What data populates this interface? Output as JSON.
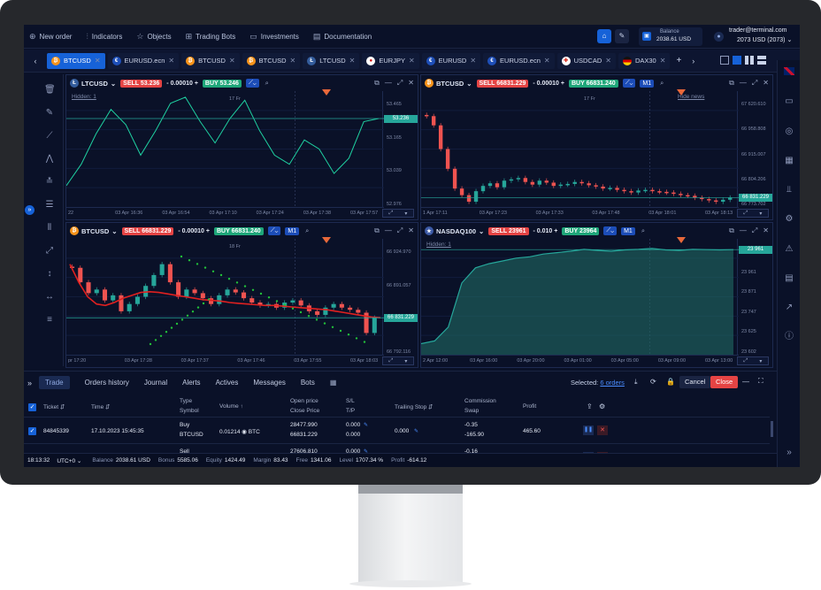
{
  "menu": [
    {
      "icon": "plus-circle-icon",
      "label": "New order"
    },
    {
      "icon": "indicators-icon",
      "label": "Indicators"
    },
    {
      "icon": "star-icon",
      "label": "Objects"
    },
    {
      "icon": "bot-icon",
      "label": "Trading Bots"
    },
    {
      "icon": "wallet-icon",
      "label": "Investments"
    },
    {
      "icon": "doc-icon",
      "label": "Documentation"
    }
  ],
  "balance": {
    "label": "Balance",
    "value": "2038.61 USD"
  },
  "account": {
    "email": "trader@terminal.com",
    "line": "2073 USD (2073)"
  },
  "tabs": [
    {
      "label": "BTCUSD",
      "flag": "btc",
      "active": true
    },
    {
      "label": "EURUSD.ecn",
      "flag": "eu"
    },
    {
      "label": "BTCUSD",
      "flag": "btc"
    },
    {
      "label": "BTCUSD",
      "flag": "btc"
    },
    {
      "label": "LTCUSD",
      "flag": "ltc"
    },
    {
      "label": "EURJPY",
      "flag": "jp"
    },
    {
      "label": "EURUSD",
      "flag": "eu"
    },
    {
      "label": "EURUSD.ecn",
      "flag": "eu"
    },
    {
      "label": "USDCAD",
      "flag": "ca"
    },
    {
      "label": "DAX30",
      "flag": "de"
    }
  ],
  "charts": [
    {
      "symbol": "LTCUSD",
      "sell": "53.236",
      "spread": "- 0.00010 +",
      "buy": "53.246",
      "tf": "",
      "hidden": "Hidden: 1",
      "yticks": [
        "53.465",
        "53.165",
        "53.039",
        "52.976"
      ],
      "price": "53.236",
      "xticks": [
        "22",
        "03 Apr 16:36",
        "03 Apr 16:54",
        "03 Apr 17:10",
        "03 Apr 17:24",
        "03 Apr 17:38",
        "03 Apr 17:57"
      ],
      "marker": "17 Fr"
    },
    {
      "symbol": "BTCUSD",
      "sell": "66831.229",
      "spread": "- 0.00010 +",
      "buy": "66831.240",
      "tf": "M1",
      "hidden": "Hide news",
      "yticks": [
        "67 620.610",
        "66 958.808",
        "66 915.007",
        "66 804.206",
        "66 773.702"
      ],
      "price": "66 831.229",
      "xticks": [
        "1 Apr 17:11",
        "03 Apr 17:23",
        "03 Apr 17:33",
        "03 Apr 17:48",
        "03 Apr 18:01",
        "03 Apr 18:13"
      ],
      "marker": "17 Fr"
    },
    {
      "symbol": "BTCUSD",
      "sell": "66831.229",
      "spread": "- 0.00010 +",
      "buy": "66831.240",
      "tf": "M1",
      "hidden": "",
      "yticks": [
        "66 924.970",
        "66 891.057",
        "66 858.543",
        "66 792.116"
      ],
      "price": "66 831.229",
      "xticks": [
        "pr 17:20",
        "03 Apr 17:28",
        "03 Apr 17:37",
        "03 Apr 17:46",
        "03 Apr 17:55",
        "03 Apr 18:03"
      ],
      "marker": "18 Fr"
    },
    {
      "symbol": "NASDAQ100",
      "sell": "23961",
      "spread": "- 0.010 +",
      "buy": "23964",
      "tf": "M1",
      "hidden": "Hidden: 1",
      "yticks": [
        "23 980",
        "23 961",
        "23 871",
        "23 747",
        "23 625",
        "23 602"
      ],
      "price": "23 961",
      "xticks": [
        "2 Apr 12:00",
        "03 Apr 16:00",
        "03 Apr 20:00",
        "03 Apr 01:00",
        "03 Apr 05:00",
        "03 Apr 09:00",
        "03 Apr 13:00"
      ],
      "marker": ""
    }
  ],
  "panel": {
    "tabs": [
      "Trade",
      "Orders history",
      "Journal",
      "Alerts",
      "Actives",
      "Messages",
      "Bots"
    ],
    "selected_label": "Selected:",
    "selected_value": "6 orders",
    "cancel": "Cancel",
    "close": "Close",
    "headers": {
      "ticket": "Ticket ⇵",
      "time": "Time ⇵",
      "type": "Type",
      "symbol": "Symbol",
      "volume": "Volume ↑",
      "open": "Open price",
      "closep": "Close Price",
      "sl": "S/L",
      "tp": "T/P",
      "trailing": "Trailing Stop ⇵",
      "commission": "Commission",
      "swap": "Swap",
      "profit": "Profit"
    },
    "rows": [
      {
        "ticket": "84845339",
        "time": "17.10.2023 15:45:35",
        "type": "Buy",
        "symbol": "BTCUSD",
        "volume": "0.01214 ◉ BTC",
        "open": "28477.990",
        "closep": "66831.229",
        "sl": "0.000",
        "tp": "0.000",
        "trailing": "0.000",
        "commission": "-0.35",
        "swap": "-165.90",
        "profit": "465.60"
      },
      {
        "ticket": "84580332",
        "time": "17.10.2023 15:45:35",
        "type": "Sell",
        "symbol": "BTCUSD",
        "volume": "",
        "open": "27606.810",
        "closep": "",
        "sl": "0.000",
        "tp": "",
        "trailing": "",
        "commission": "-0.16",
        "swap": "",
        "profit": "-325.55"
      }
    ]
  },
  "status": {
    "time": "18:13:32",
    "tz": "UTC+0",
    "items": [
      {
        "k": "Balance",
        "v": "2038.61 USD"
      },
      {
        "k": "Bonus",
        "v": "5585.06"
      },
      {
        "k": "Equity",
        "v": "1424.49"
      },
      {
        "k": "Margin",
        "v": "83.43"
      },
      {
        "k": "Free",
        "v": "1341.06"
      },
      {
        "k": "Level",
        "v": "1707.34 %"
      },
      {
        "k": "Profit",
        "v": "-614.12"
      }
    ]
  },
  "chart_data": [
    {
      "type": "line",
      "title": "LTCUSD",
      "x": [
        "03 Apr 16:36",
        "03 Apr 16:54",
        "03 Apr 17:10",
        "03 Apr 17:24",
        "03 Apr 17:38",
        "03 Apr 17:57"
      ],
      "values": [
        53.02,
        53.09,
        53.19,
        53.27,
        53.22,
        53.12,
        53.2,
        53.29,
        53.31,
        53.23,
        53.16,
        53.24,
        53.3,
        53.2,
        53.12,
        53.09,
        53.17,
        53.14,
        53.06,
        53.11,
        53.23,
        53.24
      ],
      "ylim": [
        52.95,
        53.33
      ]
    },
    {
      "type": "candlestick",
      "title": "BTCUSD",
      "ylim": [
        66760,
        67640
      ],
      "closes": [
        67450,
        67380,
        67200,
        67050,
        66900,
        66850,
        66800,
        66880,
        66920,
        66940,
        66910,
        66960,
        66970,
        66980,
        66950,
        66930,
        66960,
        66945,
        66920,
        66930,
        66935,
        66950,
        66940,
        66925,
        66915,
        66900,
        66905,
        66890,
        66880,
        66870,
        66885,
        66890,
        66880,
        66875,
        66870,
        66860,
        66850,
        66845,
        66830,
        66820,
        66810,
        66800,
        66815,
        66831
      ]
    },
    {
      "type": "candlestick",
      "title": "BTCUSD",
      "ylim": [
        66780,
        66940
      ],
      "closes": [
        66900,
        66880,
        66865,
        66870,
        66855,
        66862,
        66840,
        66850,
        66860,
        66875,
        66890,
        66905,
        66880,
        66860,
        66870,
        66865,
        66858,
        66850,
        66862,
        66870,
        66866,
        66858,
        66852,
        66848,
        66850,
        66845,
        66852,
        66855,
        66848,
        66840,
        66835,
        66845,
        66850,
        66845,
        66842,
        66838,
        66810,
        66831
      ],
      "ma": [
        66905,
        66880,
        66860,
        66850,
        66848,
        66852,
        66858,
        66862,
        66866,
        66867,
        66866,
        66864,
        66862,
        66860,
        66858,
        66856,
        66855,
        66854,
        66852,
        66851,
        66850,
        66849,
        66848,
        66848,
        66847,
        66846,
        66845,
        66844,
        66843,
        66842,
        66840,
        66838,
        66836,
        66834,
        66832,
        66831
      ]
    },
    {
      "type": "area",
      "title": "NASDAQ100",
      "ylim": [
        23580,
        24000
      ],
      "values": [
        23620,
        23630,
        23680,
        23840,
        23895,
        23910,
        23920,
        23930,
        23935,
        23945,
        23950,
        23955,
        23962,
        23958,
        23955,
        23960,
        23962,
        23965,
        23960,
        23958,
        23962,
        23961,
        23960,
        23961
      ]
    }
  ],
  "colors": {
    "bg": "#0a1128",
    "up": "#26a69a",
    "down": "#ef5350",
    "accent": "#1662d8",
    "line": "#1fd1a1"
  }
}
